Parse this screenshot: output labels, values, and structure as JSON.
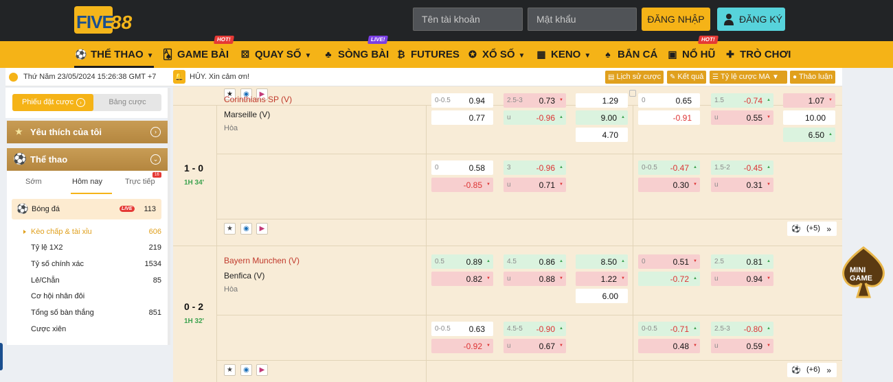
{
  "header": {
    "logo_text": "FIVE",
    "logo_num": "88",
    "username_placeholder": "Tên tài khoản",
    "password_placeholder": "Mật khẩu",
    "login_label": "ĐĂNG NHẬP",
    "register_label": "ĐĂNG KÝ"
  },
  "nav": {
    "items": [
      {
        "label": "THỂ THAO",
        "icon": "soccer-player-icon"
      },
      {
        "label": "GAME BÀI",
        "icon": "cards-icon",
        "tag": "HOT!"
      },
      {
        "label": "QUAY SỐ",
        "icon": "dice-icon",
        "tag": ""
      },
      {
        "label": "SÒNG BÀI",
        "icon": "casino-icon",
        "tag": "LIVE!"
      },
      {
        "label": "FUTURES",
        "icon": "bitcoin-icon"
      },
      {
        "label": "XỔ SỐ",
        "icon": "lottery-ball-icon"
      },
      {
        "label": "KENO",
        "icon": "keno-icon"
      },
      {
        "label": "BẮN CÁ",
        "icon": "fish-icon"
      },
      {
        "label": "NỔ HŨ",
        "icon": "slot-icon",
        "tag": "HOT!"
      },
      {
        "label": "TRÒ CHƠI",
        "icon": "gamepad-icon"
      }
    ]
  },
  "infobar": {
    "datetime": "Thứ Năm 23/05/2024 15:26:38 GMT +7",
    "notice": "HỦY. Xin cảm ơn!",
    "buttons": [
      "Lịch sử cược",
      "Kết quả",
      "Tỷ lệ cược MA",
      "Thảo luận"
    ]
  },
  "sidebar": {
    "seg_active": "Phiếu đặt cược",
    "seg_inactive": "Bảng cược",
    "favorites": "Yêu thích của tôi",
    "sports": "Thể thao",
    "tabs": [
      "Sớm",
      "Hôm nay",
      "Trực tiếp"
    ],
    "tab_badge": "16",
    "football": {
      "label": "Bóng đá",
      "live": "LIVE",
      "count": "113"
    },
    "markets": [
      {
        "label": "Kèo chấp & tài xỉu",
        "count": "606"
      },
      {
        "label": "Tỷ lệ 1X2",
        "count": "219"
      },
      {
        "label": "Tỷ số chính xác",
        "count": "1534"
      },
      {
        "label": "Lẻ/Chẵn",
        "count": "85"
      },
      {
        "label": "Cơ hội nhân đôi",
        "count": ""
      },
      {
        "label": "Tổng số bàn thắng",
        "count": "851"
      },
      {
        "label": "Cược xiên",
        "count": ""
      }
    ]
  },
  "matches": [
    {
      "score": "1 - 0",
      "time": "1H 34'",
      "home": "Corinthians SP (V)",
      "away": "Marseille (V)",
      "draw": "Hòa",
      "more": "(+5)",
      "row1": {
        "ft_hdp": {
          "h1": "0-0.5",
          "v1": "0.94",
          "h2": "",
          "v2": "0.77"
        },
        "ft_ou": {
          "h1": "2.5-3",
          "v1": "0.73",
          "h2": "u",
          "v2": "-0.96"
        },
        "ft_1x2": [
          "1.29",
          "9.00",
          "4.70"
        ],
        "h1_hdp": {
          "h1": "0",
          "v1": "0.65",
          "h2": "",
          "v2": "-0.91"
        },
        "h1_ou": {
          "h1": "1.5",
          "v1": "-0.74",
          "h2": "u",
          "v2": "0.55"
        },
        "h1_1x2": [
          "1.07",
          "10.00",
          "6.50"
        ]
      },
      "row2": {
        "ft_hdp": {
          "h1": "0",
          "v1": "0.58",
          "h2": "",
          "v2": "-0.85"
        },
        "ft_ou": {
          "h1": "3",
          "v1": "-0.96",
          "h2": "u",
          "v2": "0.71"
        },
        "h1_hdp": {
          "h1": "0-0.5",
          "v1": "-0.47",
          "h2": "",
          "v2": "0.30"
        },
        "h1_ou": {
          "h1": "1.5-2",
          "v1": "-0.45",
          "h2": "u",
          "v2": "0.31"
        }
      }
    },
    {
      "score": "0 - 2",
      "time": "1H 32'",
      "home": "Bayern Munchen (V)",
      "away": "Benfica (V)",
      "draw": "Hòa",
      "more": "(+6)",
      "row1": {
        "ft_hdp": {
          "h1": "0.5",
          "v1": "0.89",
          "h2": "",
          "v2": "0.82"
        },
        "ft_ou": {
          "h1": "4.5",
          "v1": "0.86",
          "h2": "u",
          "v2": "0.88"
        },
        "ft_1x2": [
          "8.50",
          "1.22",
          "6.00"
        ],
        "h1_hdp": {
          "h1": "0",
          "v1": "0.51",
          "h2": "",
          "v2": "-0.72"
        },
        "h1_ou": {
          "h1": "2.5",
          "v1": "0.81",
          "h2": "u",
          "v2": "0.94"
        }
      },
      "row2": {
        "ft_hdp": {
          "h1": "0-0.5",
          "v1": "0.63",
          "h2": "",
          "v2": "-0.92"
        },
        "ft_ou": {
          "h1": "4.5-5",
          "v1": "-0.90",
          "h2": "u",
          "v2": "0.67"
        },
        "h1_hdp": {
          "h1": "0-0.5",
          "v1": "-0.71",
          "h2": "",
          "v2": "0.48"
        },
        "h1_ou": {
          "h1": "2.5-3",
          "v1": "-0.80",
          "h2": "u",
          "v2": "0.59"
        }
      }
    }
  ],
  "minigame_label": "MINI GAME",
  "colors": {
    "brand": "#f5b317",
    "header": "#222426",
    "register": "#57d3db",
    "odds_up": "#dbf3df",
    "odds_down": "#f7cfcf",
    "panel": "#f8ecd7"
  }
}
